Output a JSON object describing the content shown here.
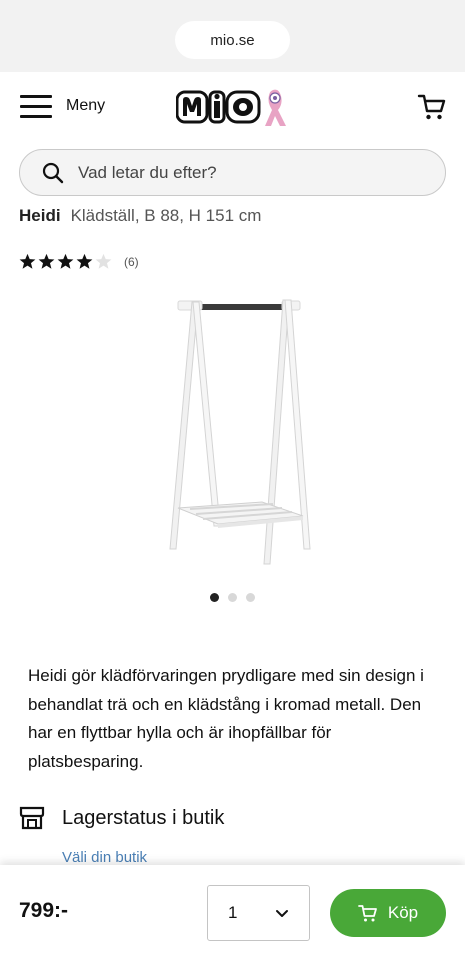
{
  "browser": {
    "url": "mio.se"
  },
  "header": {
    "menu_label": "Meny",
    "logo_text": "MIO"
  },
  "search": {
    "placeholder": "Vad letar du efter?"
  },
  "product": {
    "brand": "Heidi",
    "subtitle": "Klädställ, B 88, H 151 cm",
    "rating": 4,
    "rating_max": 5,
    "review_count": "(6)",
    "image_count": 3,
    "active_image": 1,
    "description": "Heidi gör klädförvaringen prydligare med sin design i behandlat trä och en klädstång i kromad metall. Den har en flyttbar hylla och är ihopfällbar för platsbesparing."
  },
  "stock": {
    "label": "Lagerstatus i butik",
    "choose_store": "Väli din butik"
  },
  "purchase": {
    "price": "799:-",
    "quantity": "1",
    "buy_label": "Köp"
  },
  "colors": {
    "accent_green": "#49a838",
    "link_blue": "#4a7fb5"
  }
}
